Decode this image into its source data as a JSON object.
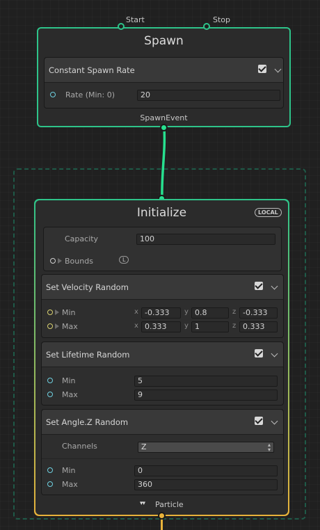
{
  "spawn": {
    "title": "Spawn",
    "port_start": "Start",
    "port_stop": "Stop",
    "output_label": "SpawnEvent",
    "block": {
      "title": "Constant Spawn Rate",
      "enabled": true,
      "rate_label": "Rate (Min: 0)",
      "rate_value": "20"
    }
  },
  "initialize": {
    "title": "Initialize",
    "space_badge": "LOCAL",
    "capacity_label": "Capacity",
    "capacity_value": "100",
    "bounds_label": "Bounds",
    "bounds_badge": "L",
    "output_label": "Particle",
    "velocity_block": {
      "title": "Set Velocity Random",
      "enabled": true,
      "min_label": "Min",
      "max_label": "Max",
      "axis_x": "x",
      "axis_y": "y",
      "axis_z": "z",
      "min_x": "-0.333",
      "min_y": "0.8",
      "min_z": "-0.333",
      "max_x": "0.333",
      "max_y": "1",
      "max_z": "0.333"
    },
    "lifetime_block": {
      "title": "Set Lifetime Random",
      "enabled": true,
      "min_label": "Min",
      "max_label": "Max",
      "min_value": "5",
      "max_value": "9"
    },
    "angle_block": {
      "title": "Set Angle.Z Random",
      "enabled": true,
      "channels_label": "Channels",
      "channels_value": "Z",
      "min_label": "Min",
      "max_label": "Max",
      "min_value": "0",
      "max_value": "360"
    }
  },
  "colors": {
    "spawn_accent": "#2ec48a",
    "link": "#27e08f",
    "init_gradient_top": "#2ec48a",
    "init_gradient_bottom": "#e8b23a",
    "particle_link": "#e8b23a"
  }
}
